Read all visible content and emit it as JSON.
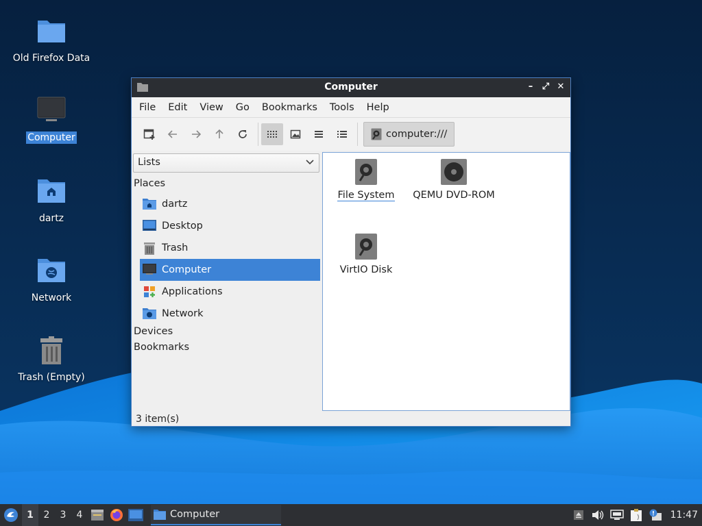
{
  "desktop": {
    "icons": [
      {
        "label": "Old Firefox Data",
        "icon": "folder-icon"
      },
      {
        "label": "Computer",
        "icon": "computer-icon",
        "selected": true
      },
      {
        "label": "dartz",
        "icon": "home-folder-icon"
      },
      {
        "label": "Network",
        "icon": "network-folder-icon"
      },
      {
        "label": "Trash (Empty)",
        "icon": "trash-icon"
      }
    ]
  },
  "window": {
    "title": "Computer",
    "controls": {
      "minimize": "–",
      "maximize": "⤢",
      "close": "✕"
    },
    "menu": [
      "File",
      "Edit",
      "View",
      "Go",
      "Bookmarks",
      "Tools",
      "Help"
    ],
    "toolbar": {
      "buttons": [
        "new-tab-icon",
        "back-icon",
        "forward-icon",
        "up-icon",
        "reload-icon",
        "icon-view-icon",
        "thumbnail-view-icon",
        "compact-view-icon",
        "detailed-view-icon"
      ],
      "active_view": "icon-view-icon",
      "location": "computer:///"
    },
    "side_pane": {
      "mode": "Lists",
      "places_heading": "Places",
      "places": [
        {
          "label": "dartz",
          "icon": "home-folder-icon"
        },
        {
          "label": "Desktop",
          "icon": "desktop-icon"
        },
        {
          "label": "Trash",
          "icon": "trash-icon"
        },
        {
          "label": "Computer",
          "icon": "computer-icon",
          "selected": true
        },
        {
          "label": "Applications",
          "icon": "applications-icon"
        },
        {
          "label": "Network",
          "icon": "network-folder-icon"
        }
      ],
      "devices_heading": "Devices",
      "bookmarks_heading": "Bookmarks"
    },
    "items": [
      {
        "label": "File System",
        "icon": "drive-icon",
        "focused": true
      },
      {
        "label": "QEMU DVD-ROM",
        "icon": "optical-drive-icon"
      },
      {
        "label": "VirtIO Disk",
        "icon": "drive-icon"
      }
    ],
    "status": "3 item(s)"
  },
  "taskbar": {
    "workspaces": [
      "1",
      "2",
      "3",
      "4"
    ],
    "active_workspace": "1",
    "launchers": [
      "file-manager-icon",
      "firefox-icon",
      "show-desktop-icon"
    ],
    "task": {
      "label": "Computer",
      "icon": "folder-icon"
    },
    "tray": [
      "eject-icon",
      "volume-icon",
      "network-icon",
      "clipboard-icon",
      "update-icon"
    ],
    "clock": "11:47"
  },
  "colors": {
    "accent": "#3d83d6",
    "titlebar": "#2b2e33",
    "taskbar": "#2d2f33",
    "folder": "#5b9be6"
  }
}
